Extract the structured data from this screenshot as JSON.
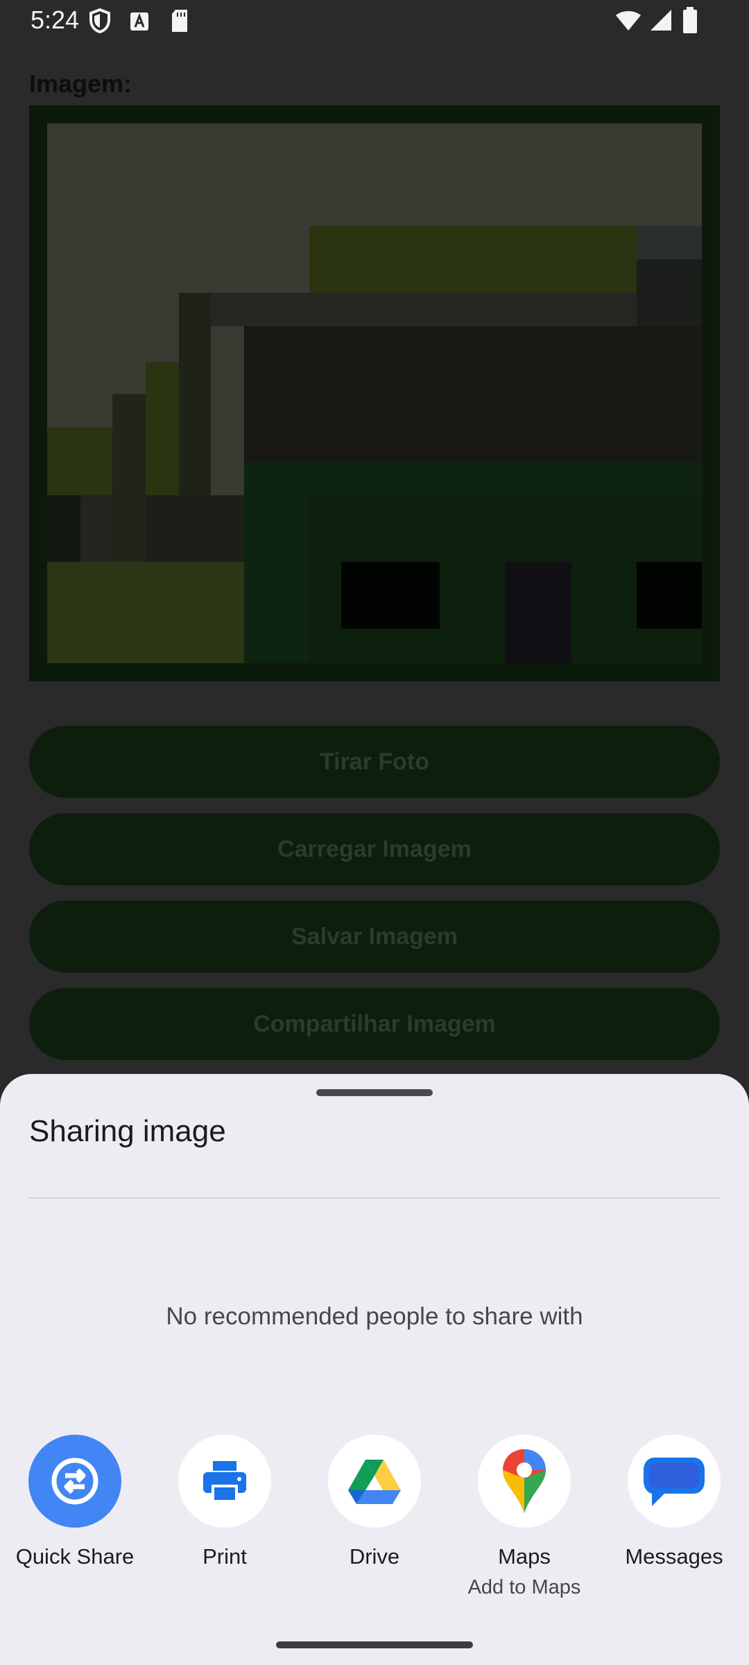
{
  "status_bar": {
    "time": "5:24",
    "left_icons": [
      "shield-icon",
      "a-badge-icon",
      "sd-card-icon"
    ],
    "right_icons": [
      "wifi-icon",
      "signal-icon",
      "battery-icon"
    ]
  },
  "app": {
    "image_label": "Imagem:",
    "buttons": [
      "Tirar Foto",
      "Carregar Imagem",
      "Salvar Imagem",
      "Compartilhar Imagem"
    ]
  },
  "share_sheet": {
    "title": "Sharing image",
    "empty_message": "No recommended people to share with",
    "targets": [
      {
        "label": "Quick Share",
        "sublabel": "",
        "icon": "quick-share-icon"
      },
      {
        "label": "Print",
        "sublabel": "",
        "icon": "printer-icon"
      },
      {
        "label": "Drive",
        "sublabel": "",
        "icon": "drive-icon"
      },
      {
        "label": "Maps",
        "sublabel": "Add to Maps",
        "icon": "maps-pin-icon"
      },
      {
        "label": "Messages",
        "sublabel": "",
        "icon": "messages-icon"
      }
    ]
  },
  "colors": {
    "sheet_background": "#eeecf3",
    "scrim_background": "#2a2a2a",
    "quick_share_blue": "#4285f4"
  }
}
